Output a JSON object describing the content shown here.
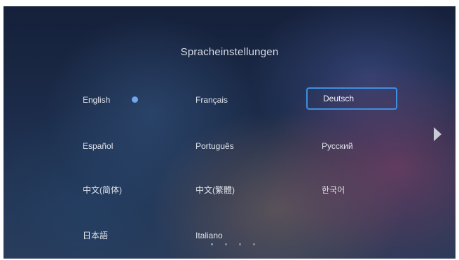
{
  "title": "Spracheinstellungen",
  "languages": [
    {
      "label": "English",
      "selected": true
    },
    {
      "label": "Français"
    },
    {
      "label": "Deutsch",
      "focused": true
    },
    {
      "label": "Español"
    },
    {
      "label": "Português"
    },
    {
      "label": "Русский"
    },
    {
      "label": "中文(简体)"
    },
    {
      "label": "中文(繁體)"
    },
    {
      "label": "한국어"
    },
    {
      "label": "日本語"
    },
    {
      "label": "Italiano"
    }
  ],
  "selected_indicator_icon": "selected-dot-icon",
  "next_page_icon": "chevron-right-icon",
  "pagination": {
    "pages": 4,
    "current": 1
  },
  "colors": {
    "accent": "#3f8fe0",
    "selected_dot": "#6fa8ee",
    "text": "#dfe3ea"
  }
}
